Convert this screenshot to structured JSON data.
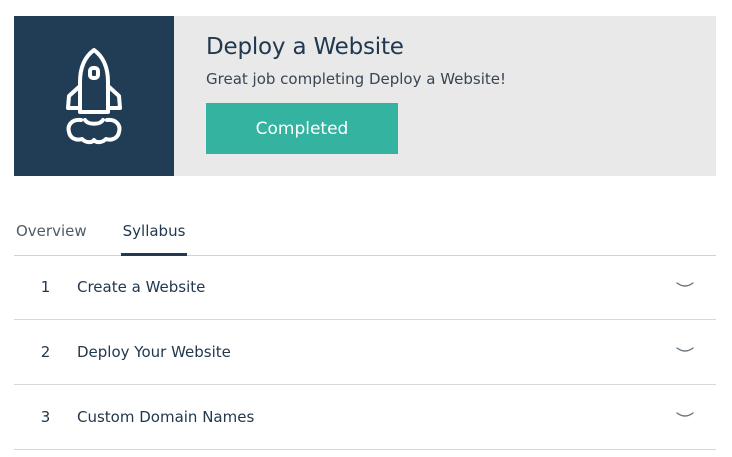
{
  "banner": {
    "icon": "rocket-icon",
    "title": "Deploy a Website",
    "subtitle": "Great job completing Deploy a Website!",
    "button_label": "Completed",
    "colors": {
      "icon_box": "#213d56",
      "background": "#e8e9e8",
      "button": "#33b3a0"
    }
  },
  "tabs": [
    {
      "label": "Overview",
      "active": false
    },
    {
      "label": "Syllabus",
      "active": true
    }
  ],
  "syllabus": [
    {
      "number": "1",
      "title": "Create a Website",
      "icon": "chevron-down-icon"
    },
    {
      "number": "2",
      "title": "Deploy Your Website",
      "icon": "chevron-down-icon"
    },
    {
      "number": "3",
      "title": "Custom Domain Names",
      "icon": "chevron-down-icon"
    }
  ]
}
